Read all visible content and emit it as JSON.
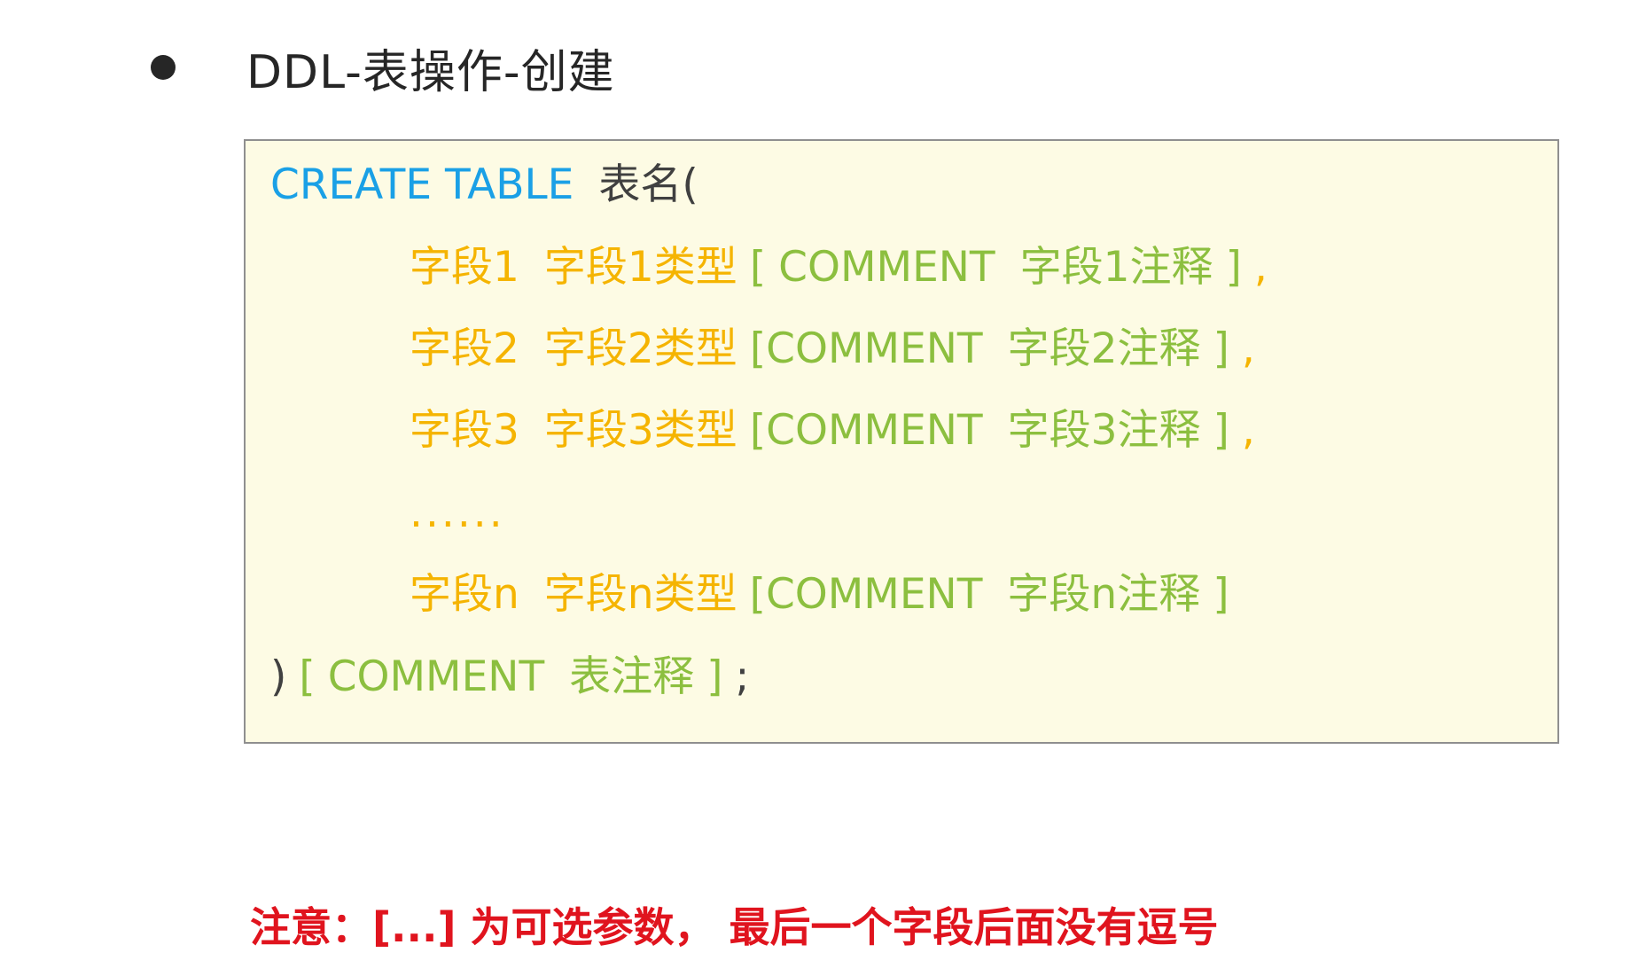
{
  "heading": {
    "title": "DDL-表操作-创建"
  },
  "code": {
    "line0": {
      "keyword": "CREATE TABLE",
      "name": "表名("
    },
    "line1": {
      "field": "字段1",
      "type": "字段1类型",
      "open": "[",
      "comment_kw": "COMMENT",
      "comment": "字段1注释",
      "close": "]",
      "sep": ","
    },
    "line2": {
      "field": "字段2",
      "type": "字段2类型",
      "open": "[",
      "comment_kw": "COMMENT",
      "comment": "字段2注释",
      "close": "]",
      "sep": ","
    },
    "line3": {
      "field": "字段3",
      "type": "字段3类型",
      "open": "[",
      "comment_kw": "COMMENT",
      "comment": "字段3注释",
      "close": "]",
      "sep": ","
    },
    "line4": {
      "ellipsis": "......"
    },
    "line5": {
      "field": "字段n",
      "type": "字段n类型",
      "open": "[",
      "comment_kw": "COMMENT",
      "comment": "字段n注释",
      "close": "]"
    },
    "line6": {
      "paren": ")",
      "open": "[",
      "comment_kw": "COMMENT",
      "comment": "表注释",
      "close": "]",
      "end": ";"
    }
  },
  "note": {
    "text": "注意：[...] 为可选参数， 最后一个字段后面没有逗号"
  },
  "colors": {
    "keyword": "#1aa0e6",
    "field": "#f5b400",
    "comment": "#8cbf3f",
    "note": "#e0141e",
    "box_bg": "#fdfbe4"
  }
}
